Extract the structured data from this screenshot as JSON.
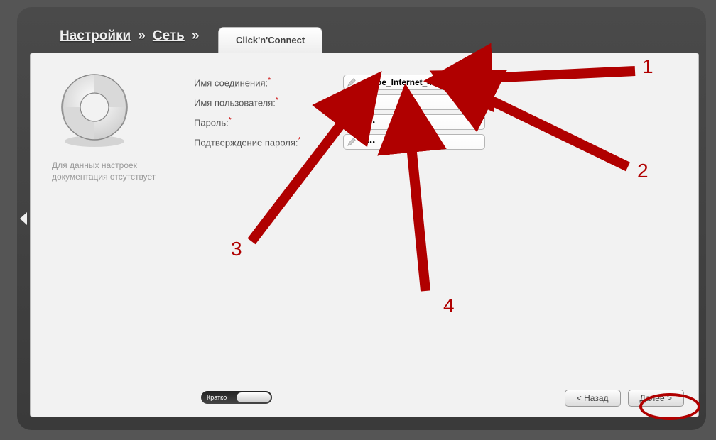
{
  "breadcrumb": {
    "settings": "Настройки",
    "network": "Сеть"
  },
  "tab": {
    "label": "Click'n'Connect"
  },
  "help": {
    "text": "Для данных настроек документация отсутствует"
  },
  "form": {
    "fields": [
      {
        "label": "Имя соединения:",
        "value": "pppoe_Internet_4",
        "type": "text"
      },
      {
        "label": "Имя пользователя:",
        "value": "",
        "type": "text"
      },
      {
        "label": "Пароль:",
        "value": "•••••",
        "type": "password"
      },
      {
        "label": "Подтверждение пароля:",
        "value": "•••••",
        "type": "password"
      }
    ]
  },
  "toggle": {
    "label": "Кратко"
  },
  "buttons": {
    "back": "< Назад",
    "next": "Далее >"
  },
  "annotations": {
    "n1": "1",
    "n2": "2",
    "n3": "3",
    "n4": "4"
  }
}
